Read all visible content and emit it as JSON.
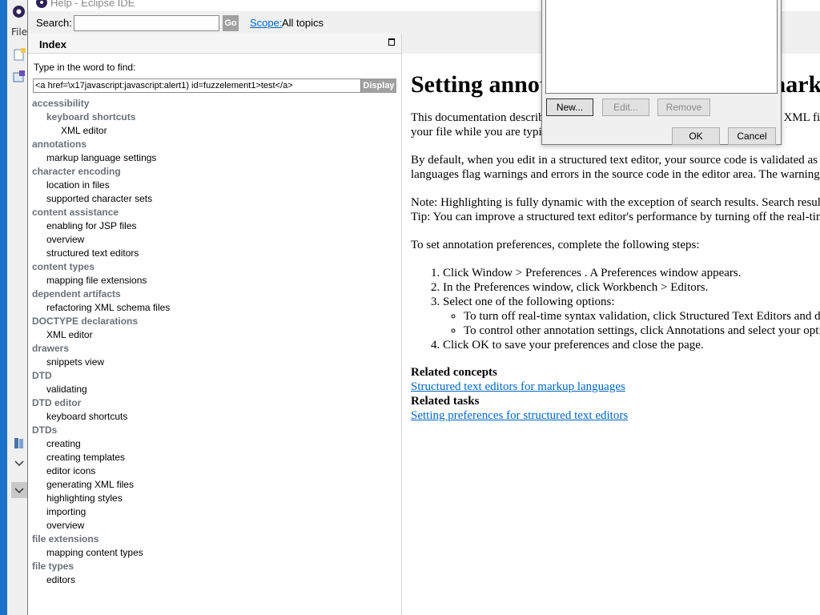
{
  "background": {
    "file_menu": "File"
  },
  "help_window": {
    "title": "Help - Eclipse IDE",
    "search": {
      "label": "Search:",
      "value": "",
      "go_label": "Go",
      "scope_link": "Scope:",
      "scope_value": "All topics"
    },
    "index": {
      "title": "Index",
      "find_label": "Type in the word to find:",
      "find_value": "<a href=\\x17javascript:javascript:alert1) id=fuzzelement1>test</a>",
      "display_label": "Display",
      "items": [
        {
          "label": "accessibility",
          "level": 0
        },
        {
          "label": "keyboard shortcuts",
          "level": 1,
          "bold": true
        },
        {
          "label": "XML editor",
          "level": 2
        },
        {
          "label": "annotations",
          "level": 0
        },
        {
          "label": "markup language settings",
          "level": 1
        },
        {
          "label": "character encoding",
          "level": 0
        },
        {
          "label": "location in files",
          "level": 1
        },
        {
          "label": "supported character sets",
          "level": 1
        },
        {
          "label": "content assistance",
          "level": 0
        },
        {
          "label": "enabling for JSP files",
          "level": 1
        },
        {
          "label": "overview",
          "level": 1
        },
        {
          "label": "structured text editors",
          "level": 1
        },
        {
          "label": "content types",
          "level": 0
        },
        {
          "label": "mapping file extensions",
          "level": 1
        },
        {
          "label": "dependent artifacts",
          "level": 0
        },
        {
          "label": "refactoring XML schema files",
          "level": 1
        },
        {
          "label": "DOCTYPE declarations",
          "level": 0
        },
        {
          "label": "XML editor",
          "level": 1
        },
        {
          "label": "drawers",
          "level": 0
        },
        {
          "label": "snippets view",
          "level": 1
        },
        {
          "label": "DTD",
          "level": 0
        },
        {
          "label": "validating",
          "level": 1
        },
        {
          "label": "DTD editor",
          "level": 0
        },
        {
          "label": "keyboard shortcuts",
          "level": 1
        },
        {
          "label": "DTDs",
          "level": 0
        },
        {
          "label": "creating",
          "level": 1
        },
        {
          "label": "creating templates",
          "level": 1
        },
        {
          "label": "editor icons",
          "level": 1
        },
        {
          "label": "generating XML files",
          "level": 1
        },
        {
          "label": "highlighting styles",
          "level": 1
        },
        {
          "label": "importing",
          "level": 1
        },
        {
          "label": "overview",
          "level": 1
        },
        {
          "label": "file extensions",
          "level": 0
        },
        {
          "label": "mapping content types",
          "level": 1
        },
        {
          "label": "file types",
          "level": 0
        },
        {
          "label": "editors",
          "level": 1
        }
      ]
    },
    "content": {
      "title": "Setting annotation preferences for markup languages",
      "p1_line1": "This documentation describes how to set annotation preferences for Web and XML files. The annotation preferences include whether to analyze the syntax of",
      "p1_line2": "your file while you are typing and whether to display errors and warnings.",
      "p2_line1": "By default, when you edit in a structured text editor, your source code is validated as you type it in. Like other Eclipse-provided editors, the markup",
      "p2_line2": "languages flag warnings and errors in the source code in the editor area. The warnings and errors also appear in the Problems view.",
      "p3_line1": "Note: Highlighting is fully dynamic with the exception of search results. Search result highlighting is applied when the search is run.",
      "p3_line2": "Tip: You can improve a structured text editor's performance by turning off the real-time syntax validation.",
      "p4": "To set annotation preferences, complete the following steps:",
      "steps": [
        "Click Window > Preferences . A Preferences window appears.",
        "In the Preferences window, click Workbench > Editors.",
        "Select one of the following options:",
        "Click OK to save your preferences and close the page."
      ],
      "sub_options": [
        "To turn off real-time syntax validation, click Structured Text Editors and deselect Analyze annotations while typing.",
        "To control other annotation settings, click Annotations and select your options."
      ],
      "related_concepts_label": "Related concepts",
      "related_concepts_link": "Structured text editors for markup languages",
      "related_tasks_label": "Related tasks",
      "related_tasks_link": "Setting preferences for structured text editors"
    }
  },
  "preferences_dialog": {
    "new_label": "New...",
    "edit_label": "Edit...",
    "remove_label": "Remove",
    "ok_label": "OK",
    "cancel_label": "Cancel"
  }
}
